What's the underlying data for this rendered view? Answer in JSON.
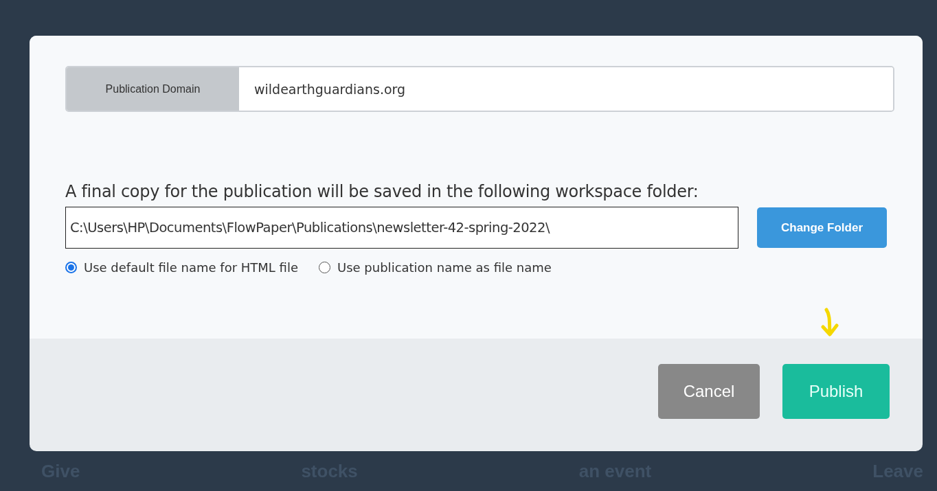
{
  "dialog": {
    "domain": {
      "label": "Publication Domain",
      "value": "wildearthguardians.org"
    },
    "folder_note": "A final copy for the publication will be saved in the following workspace folder:",
    "folder_path": "C:\\Users\\HP\\Documents\\FlowPaper\\Publications\\newsletter-42-spring-2022\\",
    "change_folder_button": "Change Folder",
    "file_name_options": [
      {
        "label": "Use default file name for HTML file",
        "selected": true
      },
      {
        "label": "Use publication name as file name",
        "selected": false
      }
    ],
    "buttons": [
      {
        "label": "Cancel",
        "kind": "secondary"
      },
      {
        "label": "Publish",
        "kind": "primary"
      }
    ]
  },
  "background_labels": [
    "Give",
    "stocks",
    "an event",
    "Leave"
  ]
}
